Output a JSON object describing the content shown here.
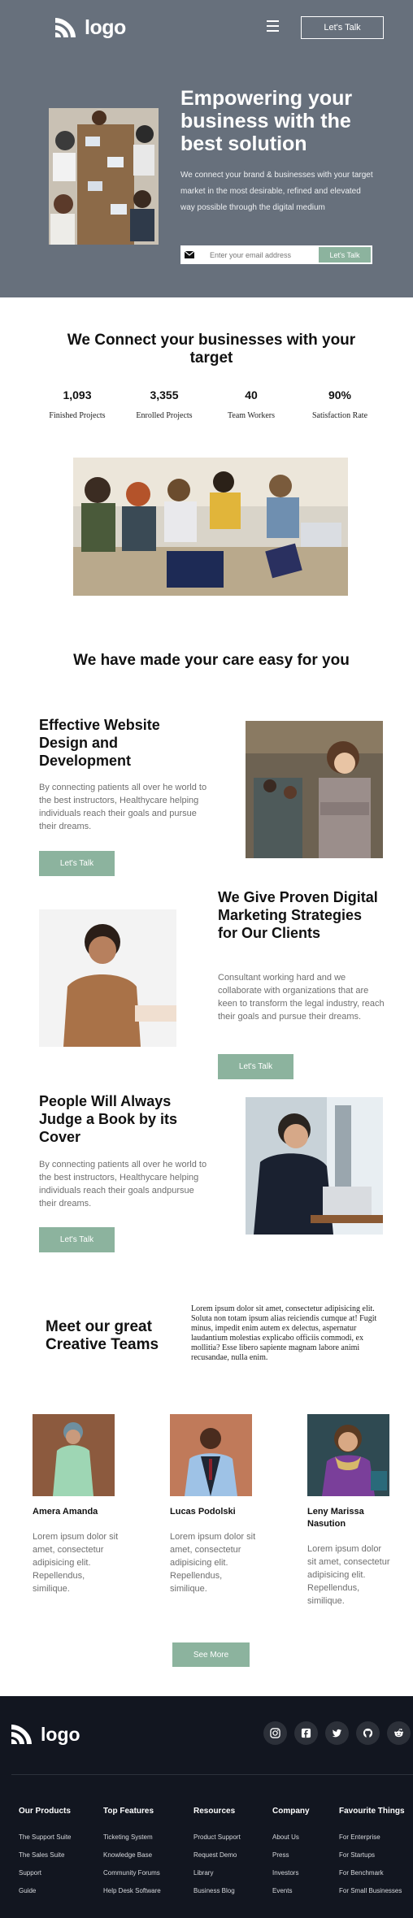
{
  "header": {
    "logo_text": "logo",
    "menu_icon": "hamburger-icon",
    "cta_label": "Let's Talk"
  },
  "hero": {
    "title": "Empowering your business with the best solution",
    "description": "We connect your brand & businesses with your target market in the most desirable, refined and elevated way possible through the digital medium",
    "email_placeholder": "Enter your email address",
    "email_icon": "mail-icon",
    "submit_label": "Let's Talk"
  },
  "connect": {
    "title": "We Connect your businesses with your target",
    "stats": [
      {
        "value": "1,093",
        "label": "Finished Projects"
      },
      {
        "value": "3,355",
        "label": "Enrolled Projects"
      },
      {
        "value": "40",
        "label": "Team Workers"
      },
      {
        "value": "90%",
        "label": "Satisfaction Rate"
      }
    ]
  },
  "care": {
    "title": "We have made your care easy for you"
  },
  "features": [
    {
      "title": "Effective Website Design and Development",
      "description": "By connecting patients all over he world to the best instructors, Healthycare helping individuals reach their goals and pursue their dreams.",
      "button": "Let's Talk"
    },
    {
      "title": "We Give Proven Digital Marketing Strategies for Our Clients",
      "description": "Consultant working hard and we collaborate with organizations that are keen to transform the legal industry, reach their goals and pursue their dreams.",
      "button": "Let's Talk"
    },
    {
      "title": "People Will Always Judge a Book by its Cover",
      "description": "By connecting patients all over he world to the best instructors, Healthycare helping individuals reach their goals andpursue their dreams.",
      "button": "Let's Talk"
    }
  ],
  "team": {
    "title": "Meet our great Creative Teams",
    "description": "Lorem ipsum dolor sit amet, consectetur adipisicing elit. Soluta non totam ipsum alias reiciendis cumque at! Fugit minus, impedit enim autem ex delectus, aspernatur laudantium molestias explicabo officiis commodi, ex mollitia? Esse libero sapiente magnam labore animi recusandae, nulla enim.",
    "members": [
      {
        "name": "Amera Amanda",
        "bio": "Lorem ipsum dolor sit amet, consectetur adipisicing elit. Repellendus, similique."
      },
      {
        "name": "Lucas Podolski",
        "bio": "Lorem ipsum dolor sit amet, consectetur adipisicing elit. Repellendus, similique."
      },
      {
        "name": "Leny Marissa Nasution",
        "bio": "Lorem ipsum dolor sit amet, consectetur adipisicing elit. Repellendus, similique."
      }
    ],
    "more_label": "See More"
  },
  "footer": {
    "logo_text": "logo",
    "socials": [
      "instagram-icon",
      "facebook-icon",
      "twitter-icon",
      "github-icon",
      "reddit-icon"
    ],
    "columns": [
      {
        "heading": "Our Products",
        "links": [
          "The Support Suite",
          "The Sales Suite",
          "Support",
          "Guide"
        ]
      },
      {
        "heading": "Top Features",
        "links": [
          "Ticketing System",
          "Knowledge Base",
          "Community Forums",
          "Help Desk Software"
        ]
      },
      {
        "heading": "Resources",
        "links": [
          "Product Support",
          "Request Demo",
          "Library",
          "Business Blog"
        ]
      },
      {
        "heading": "Company",
        "links": [
          "About Us",
          "Press",
          "Investors",
          "Events"
        ]
      },
      {
        "heading": "Favourite Things",
        "links": [
          "For Enterprise",
          "For Startups",
          "For Benchmark",
          "For Small Businesses"
        ]
      }
    ]
  },
  "colors": {
    "hero_bg": "#67707c",
    "accent_green": "#8cb39e",
    "footer_bg": "#121620"
  }
}
